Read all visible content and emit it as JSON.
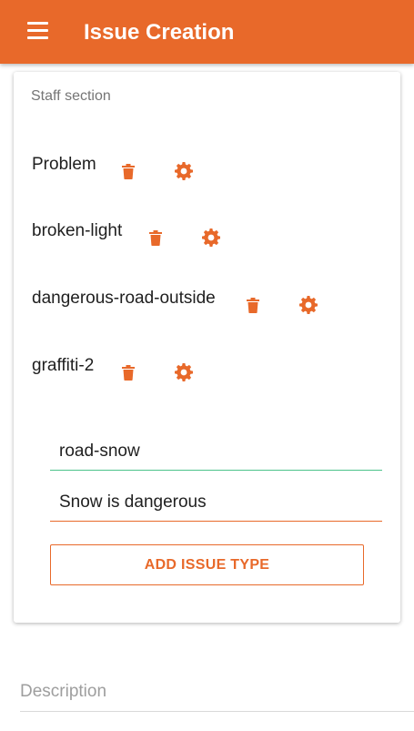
{
  "colors": {
    "accent": "#E8692A",
    "focus_valid": "#4CC38A"
  },
  "appbar": {
    "title": "Issue Creation",
    "menu_icon": "hamburger-menu-icon"
  },
  "staff_section": {
    "heading": "Staff section",
    "issue_types": [
      {
        "label": "Problem",
        "delete_icon": "trash-icon",
        "settings_icon": "gear-icon"
      },
      {
        "label": "broken-light",
        "delete_icon": "trash-icon",
        "settings_icon": "gear-icon"
      },
      {
        "label": "dangerous-road-outside",
        "delete_icon": "trash-icon",
        "settings_icon": "gear-icon"
      },
      {
        "label": "graffiti-2",
        "delete_icon": "trash-icon",
        "settings_icon": "gear-icon"
      }
    ],
    "new_type_name": {
      "value": "road-snow"
    },
    "new_type_description": {
      "value": "Snow is dangerous"
    },
    "add_button_label": "ADD ISSUE TYPE"
  },
  "description_field": {
    "placeholder": "Description"
  }
}
